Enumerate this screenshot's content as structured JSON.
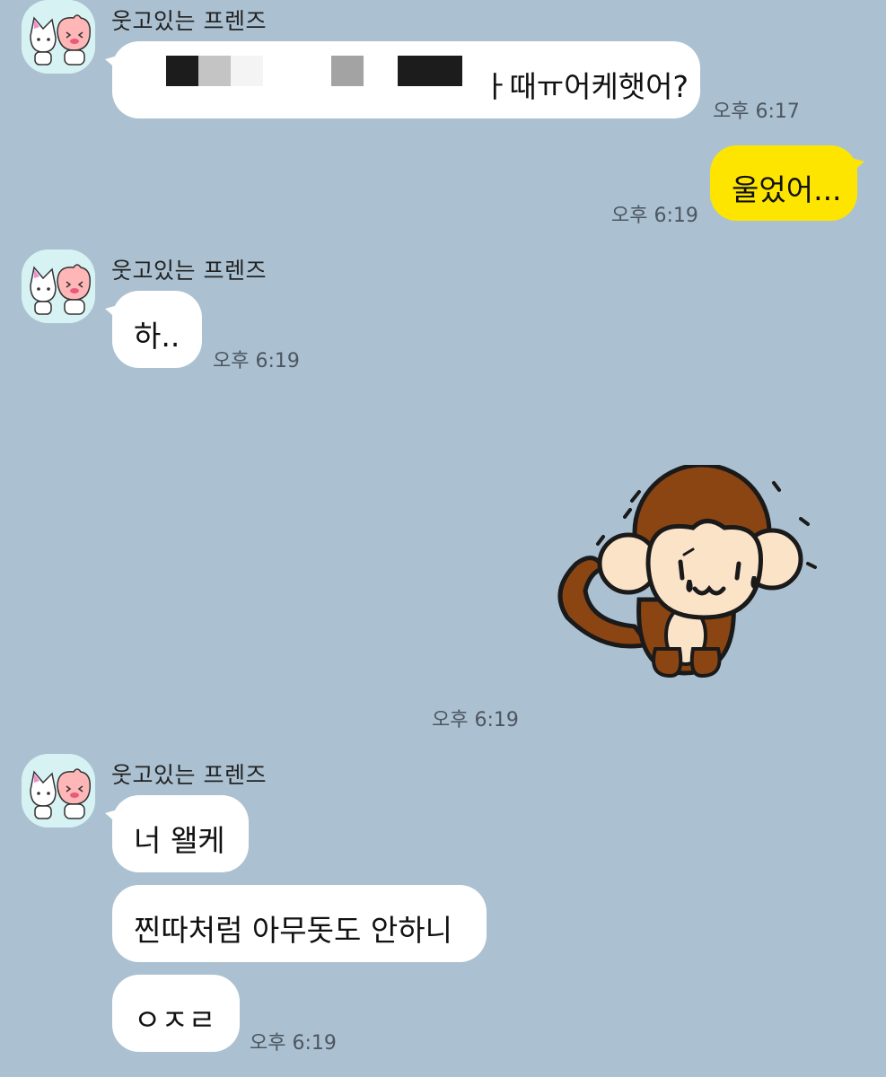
{
  "chat": {
    "sender_name": "웃고있는 프렌즈",
    "messages": [
      {
        "side": "left",
        "text": "ㅏ때ㅠ어케햇어?",
        "time": "오후 6:17"
      },
      {
        "side": "right",
        "text": "울었어...",
        "time": "오후 6:19"
      },
      {
        "side": "left",
        "text": "하..",
        "time": "오후 6:19"
      },
      {
        "side": "right",
        "sticker": "crying-monkey-sticker",
        "time": "오후 6:19"
      },
      {
        "side": "left",
        "text": "너 왤케"
      },
      {
        "side": "left",
        "text": "찐따처럼 아무돗도 안하니"
      },
      {
        "side": "left",
        "text": "ㅇㅈㄹ",
        "time": "오후 6:19"
      }
    ]
  },
  "colors": {
    "background": "#abc1d1",
    "my_bubble": "#fee500",
    "their_bubble": "#ffffff",
    "avatar_bg": "#d6f2f3"
  }
}
